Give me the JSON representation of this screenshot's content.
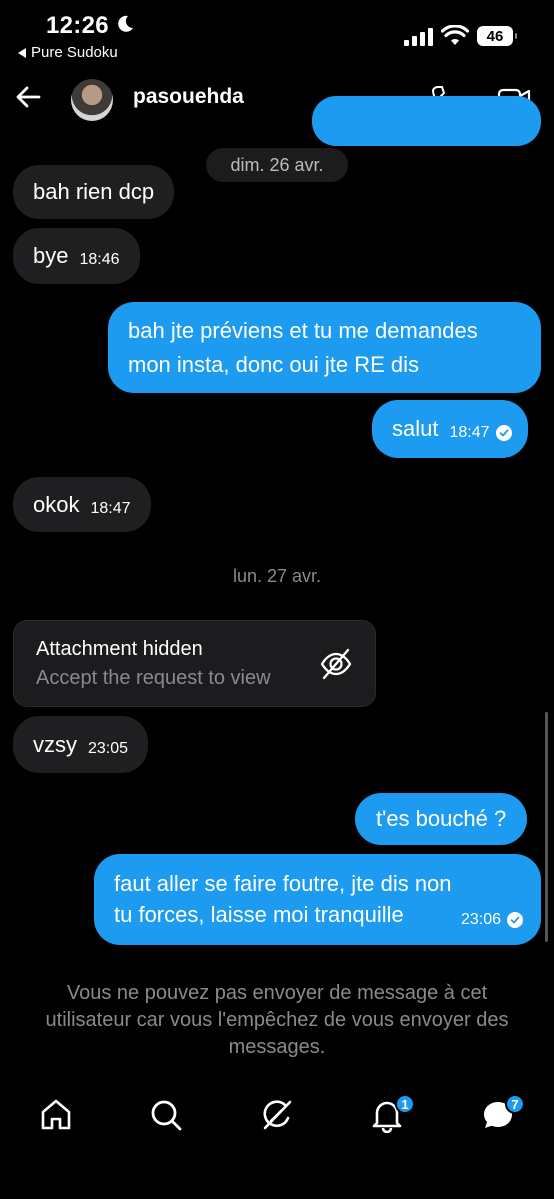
{
  "status_bar": {
    "time": "12:26",
    "back_app": "Pure Sudoku",
    "battery": "46"
  },
  "header": {
    "username": "pasouehda"
  },
  "messages": {
    "date1": "dim. 26 avr.",
    "m1": {
      "text": "bah rien dcp"
    },
    "m2": {
      "text": "bye",
      "time": "18:46"
    },
    "m3": {
      "text": "bah jte préviens et tu me demandes mon insta, donc oui jte RE dis"
    },
    "m4": {
      "text": "salut",
      "time": "18:47"
    },
    "m5": {
      "text": "okok",
      "time": "18:47"
    },
    "date2": "lun. 27 avr.",
    "attachment": {
      "title": "Attachment hidden",
      "subtitle": "Accept the request to view"
    },
    "m6": {
      "text": "vzsy",
      "time": "23:05"
    },
    "m7": {
      "text": "t'es bouché ?"
    },
    "m8": {
      "text": "faut aller se faire foutre, jte dis non tu forces, laisse moi tranquille",
      "time": "23:06"
    }
  },
  "notice": "Vous ne pouvez pas envoyer de message à cet utilisateur car vous l'empêchez de vous envoyer des messages.",
  "tabbar": {
    "notifications_badge": "1",
    "messages_badge": "7"
  },
  "colors": {
    "accent": "#1d9bf0",
    "incoming_bubble": "#1f1f21",
    "background": "#000000"
  }
}
